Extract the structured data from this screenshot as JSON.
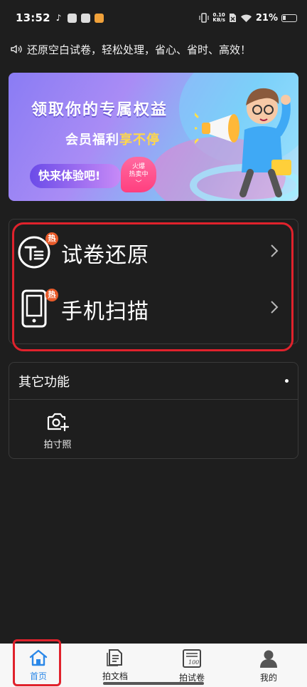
{
  "status_bar": {
    "time": "13:52",
    "net_speed_value": "0.10",
    "net_speed_unit": "KB/s",
    "battery": "21%"
  },
  "notice": {
    "text": "还原空白试卷，轻松处理，省心、省时、高效！"
  },
  "banner": {
    "title": "领取你的专属权益",
    "subtitle_prefix": "会员福利",
    "subtitle_highlight": "享不停",
    "cta": "快来体验吧!",
    "badge_line1": "火爆",
    "badge_line2": "热卖中"
  },
  "features": [
    {
      "label": "试卷还原",
      "badge": "热",
      "icon": "paper-restore-icon"
    },
    {
      "label": "手机扫描",
      "badge": "热",
      "icon": "phone-scan-icon"
    }
  ],
  "other_functions": {
    "title": "其它功能",
    "tools": [
      {
        "label": "拍寸照",
        "icon": "camera-plus-icon"
      }
    ]
  },
  "bottom_nav": {
    "items": [
      {
        "label": "首页",
        "icon": "home-icon",
        "active": true
      },
      {
        "label": "拍文档",
        "icon": "document-icon",
        "active": false
      },
      {
        "label": "拍试卷",
        "icon": "exam-paper-icon",
        "active": false
      },
      {
        "label": "我的",
        "icon": "profile-icon",
        "active": false
      }
    ]
  },
  "colors": {
    "background": "#1e1e1e",
    "accent": "#2b88e8",
    "highlight_annotation": "#e0222c",
    "hot_badge": "#e95b2a"
  }
}
